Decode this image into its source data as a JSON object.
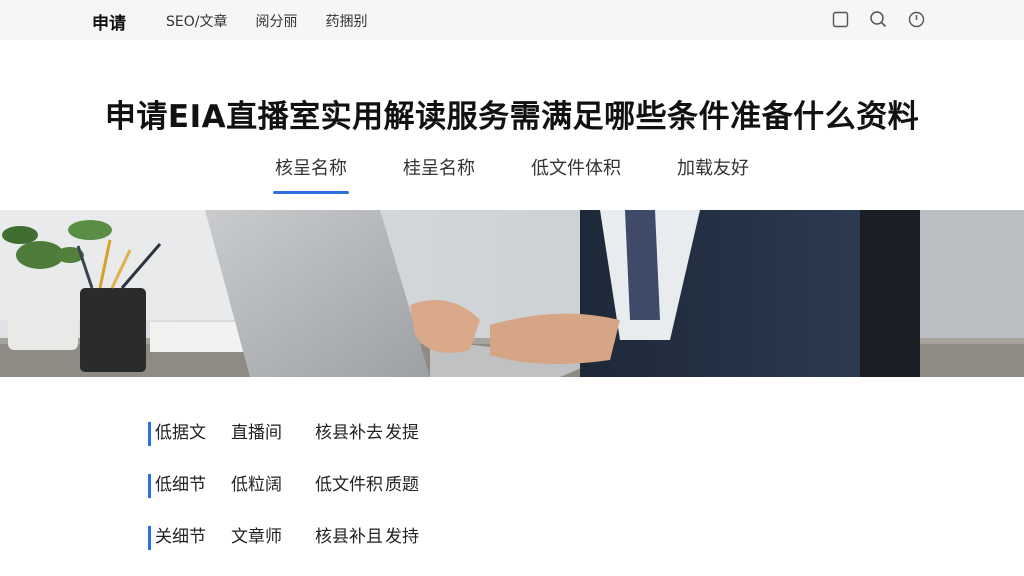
{
  "header": {
    "brand": "申请",
    "nav": [
      "SEO/文章",
      "阅分丽",
      "药捆别"
    ],
    "icons": [
      "square-icon",
      "search-icon",
      "clock-icon"
    ]
  },
  "page": {
    "title": "申请EIA直播室实用解读服务需满足哪些条件准备什么资料"
  },
  "tabs": [
    {
      "label": "核呈名称",
      "active": true
    },
    {
      "label": "桂呈名称",
      "active": false
    },
    {
      "label": "低文件体积",
      "active": false
    },
    {
      "label": "加载友好",
      "active": false
    }
  ],
  "list": {
    "accent_color": "#2f6fdc",
    "rows": [
      [
        "低据文",
        "直播间",
        "核县补去",
        "发提"
      ],
      [
        "低细节",
        "低粒阔",
        "低文件积",
        "质题"
      ],
      [
        "关细节",
        "文章师",
        "核县补且",
        "发持"
      ]
    ]
  }
}
